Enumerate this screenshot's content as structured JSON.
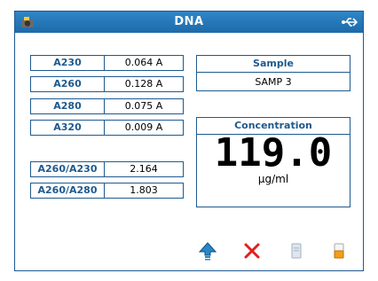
{
  "window": {
    "title": "DNA"
  },
  "icons": {
    "left": "camera-icon",
    "right": "usb-icon"
  },
  "absorbance": [
    {
      "label": "A230",
      "value": "0.064 A"
    },
    {
      "label": "A260",
      "value": "0.128 A"
    },
    {
      "label": "A280",
      "value": "0.075 A"
    },
    {
      "label": "A320",
      "value": "0.009 A"
    }
  ],
  "ratios": [
    {
      "label": "A260/A230",
      "value": "2.164"
    },
    {
      "label": "A260/A280",
      "value": "1.803"
    }
  ],
  "sample": {
    "label": "Sample",
    "value": "SAMP 3"
  },
  "concentration": {
    "label": "Concentration",
    "value": "119.0",
    "unit": "µg/ml"
  },
  "toolbar": {
    "icons": [
      "up-arrow-icon",
      "close-icon",
      "doc-icon",
      "print-icon"
    ]
  },
  "colors": {
    "title_bg": "#1d6aa8",
    "accent": "#1e5a8f",
    "close_red": "#e02020",
    "up_arrow": "#2b86c8"
  }
}
